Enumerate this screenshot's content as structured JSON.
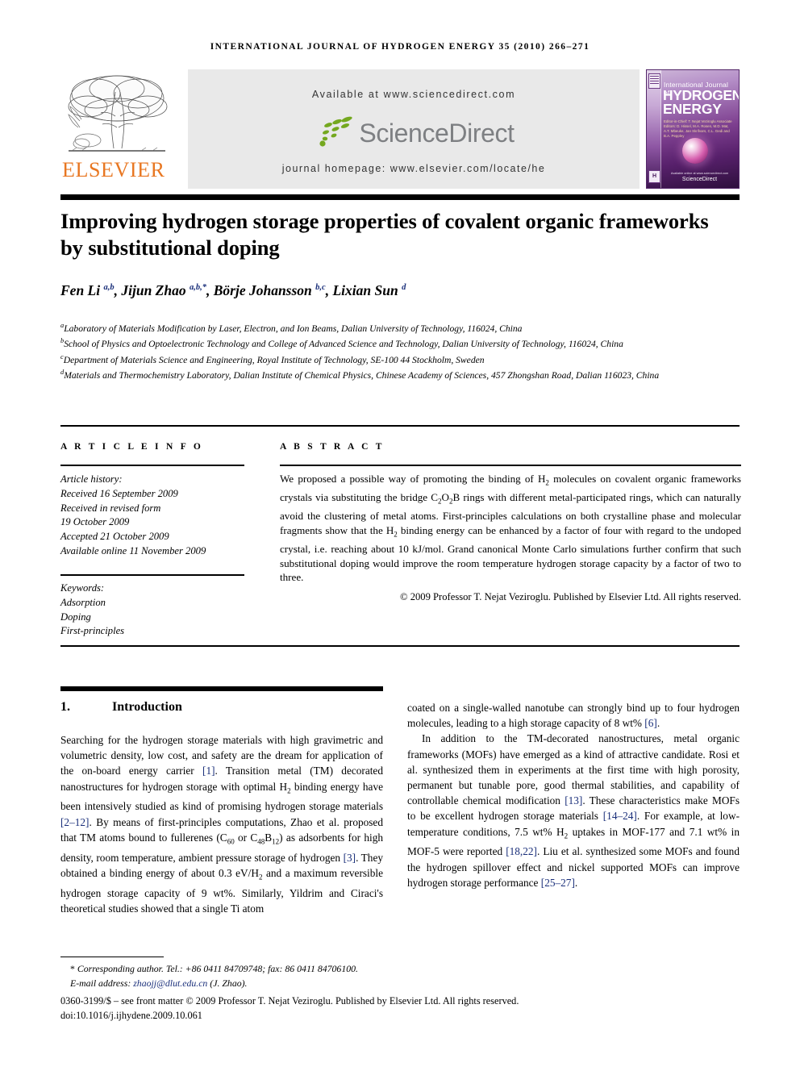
{
  "running_head": "International Journal of Hydrogen Energy 35 (2010) 266–271",
  "masthead": {
    "publisher_name": "ELSEVIER",
    "available_at": "Available at www.sciencedirect.com",
    "sciencedirect_logo_text": "ScienceDirect",
    "journal_homepage": "journal homepage: www.elsevier.com/locate/he",
    "cover": {
      "line1": "International Journal of",
      "line2": "HYDROGEN",
      "line3": "ENERGY",
      "editors": "Editor-in-Chief:  T. Nejat Veziroglu\nAssociate Editors: D. Hissel, M.A. Rosen, M.D. Mat, A.T. Mbeuke, Jan Skrifvars, C.L. Gedi and B.A. Peppley",
      "bottom_note": "Available online at www.sciencedirect.com",
      "sciencedirect": "ScienceDirect"
    }
  },
  "article": {
    "title": "Improving hydrogen storage properties of covalent organic frameworks by substitutional doping",
    "authors_html": "Fen Li <sup>a,b</sup>, Jijun Zhao <sup>a,b,*</sup>, Börje Johansson <sup>b,c</sup>, Lixian Sun <sup>d</sup>",
    "affiliations": [
      {
        "mark": "a",
        "text": "Laboratory of Materials Modification by Laser, Electron, and Ion Beams, Dalian University of Technology, 116024, China"
      },
      {
        "mark": "b",
        "text": "School of Physics and Optoelectronic Technology and College of Advanced Science and Technology, Dalian University of Technology, 116024, China"
      },
      {
        "mark": "c",
        "text": "Department of Materials Science and Engineering, Royal Institute of Technology, SE-100 44 Stockholm, Sweden"
      },
      {
        "mark": "d",
        "text": "Materials and Thermochemistry Laboratory, Dalian Institute of Chemical Physics, Chinese Academy of Sciences, 457 Zhongshan Road, Dalian 116023, China"
      }
    ]
  },
  "article_info": {
    "heading": "A R T I C L E  I N F O",
    "history_label": "Article history:",
    "history": [
      "Received 16 September 2009",
      "Received in revised form",
      "19 October 2009",
      "Accepted 21 October 2009",
      "Available online 11 November 2009"
    ],
    "keywords_label": "Keywords:",
    "keywords": [
      "Adsorption",
      "Doping",
      "First-principles"
    ]
  },
  "abstract": {
    "heading": "A B S T R A C T",
    "body_html": "We proposed a possible way of promoting the binding of H<sub>2</sub> molecules on covalent organic frameworks crystals via substituting the bridge C<sub>2</sub>O<sub>2</sub>B rings with different metal-participated rings, which can naturally avoid the clustering of metal atoms. First-principles calculations on both crystalline phase and molecular fragments show that the H<sub>2</sub> binding energy can be enhanced by a factor of four with regard to the undoped crystal, i.e. reaching about 10 kJ/mol. Grand canonical Monte Carlo simulations further confirm that such substitutional doping would improve the room temperature hydrogen storage capacity by a factor of two to three.",
    "copyright": "© 2009 Professor T. Nejat Veziroglu. Published by Elsevier Ltd. All rights reserved."
  },
  "section": {
    "number": "1.",
    "title": "Introduction"
  },
  "body": {
    "left_html": "Searching for the hydrogen storage materials with high gravimetric and volumetric density, low cost, and safety are the dream for application of the on-board energy carrier <span class=\"ref\">[1]</span>. Transition metal (TM) decorated nanostructures for hydrogen storage with optimal H<sub>2</sub> binding energy have been intensively studied as kind of promising hydrogen storage materials <span class=\"ref\">[2–12]</span>. By means of first-principles computations, Zhao et al. proposed that TM atoms bound to fullerenes (C<sub>60</sub> or C<sub>48</sub>B<sub>12</sub>) as adsorbents for high density, room temperature, ambient pressure storage of hydrogen <span class=\"ref\">[3]</span>. They obtained a binding energy of about 0.3 eV/H<sub>2</sub> and a maximum reversible hydrogen storage capacity of 9 wt%. Similarly, Yildrim and Ciraci's theoretical studies showed that a single Ti atom",
    "right_p1_html": "coated on a single-walled nanotube can strongly bind up to four hydrogen molecules, leading to a high storage capacity of 8 wt% <span class=\"ref\">[6]</span>.",
    "right_p2_html": "In addition to the TM-decorated nanostructures, metal organic frameworks (MOFs) have emerged as a kind of attractive candidate. Rosi et al. synthesized them in experiments at the first time with high porosity, permanent but tunable pore, good thermal stabilities, and capability of controllable chemical modification <span class=\"ref\">[13]</span>. These characteristics make MOFs to be excellent hydrogen storage materials <span class=\"ref\">[14–24]</span>. For example, at low-temperature conditions, 7.5 wt% H<sub>2</sub> uptakes in MOF-177 and 7.1 wt% in MOF-5 were reported <span class=\"ref\">[18,22]</span>. Liu et al. synthesized some MOFs and found the hydrogen spillover effect and nickel supported MOFs can improve hydrogen storage performance <span class=\"ref\">[25–27]</span>."
  },
  "footnotes": {
    "corresponding_html": "<span class=\"star\">*</span> <i>Corresponding author. Tel.: +86 0411 84709748; fax: 86 0411 84706100.</i>",
    "email_label": "E-mail address:",
    "email": "zhaojj@dlut.edu.cn",
    "email_suffix": "(J. Zhao).",
    "issn_line": "0360-3199/$ – see front matter © 2009 Professor T. Nejat Veziroglu. Published by Elsevier Ltd. All rights reserved.",
    "doi_line": "doi:10.1016/j.ijhydene.2009.10.061"
  },
  "colors": {
    "elsevier_orange": "#E87722",
    "reference_blue": "#1a2f7a",
    "banner_gray": "#e9e9e9",
    "sciencedirect_green": "#74A81F",
    "sciencedirect_gray": "#7e8083"
  }
}
